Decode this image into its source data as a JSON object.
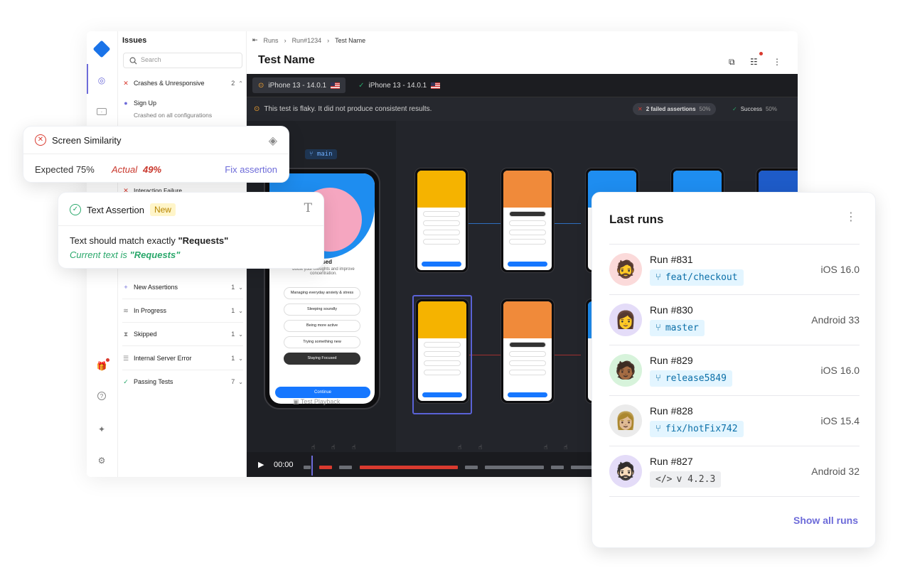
{
  "breadcrumb": [
    "Runs",
    "Run#1234",
    "Test Name"
  ],
  "test_title": "Test Name",
  "issues": {
    "title": "Issues",
    "search_placeholder": "Search",
    "groups": [
      {
        "label": "Crashes & Unresponsive",
        "count": "2",
        "status": "error"
      },
      {
        "label": "New Assertions",
        "count": "1",
        "status": "new"
      },
      {
        "label": "In Progress",
        "count": "1",
        "status": "progress"
      },
      {
        "label": "Skipped",
        "count": "1",
        "status": "skipped"
      },
      {
        "label": "Internal Server Error",
        "count": "1",
        "status": "server"
      },
      {
        "label": "Passing Tests",
        "count": "7",
        "status": "pass"
      }
    ],
    "sub_item": {
      "label": "Sign Up",
      "desc": "Crashed on all configurations"
    },
    "partial_row": "Interaction Failure"
  },
  "device_tabs": [
    {
      "label": "iPhone 13 - 14.0.1",
      "status": "warning"
    },
    {
      "label": "iPhone 13 - 14.0.1",
      "status": "ok"
    }
  ],
  "flaky_notice": "This test is flaky. It did not produce consistent results.",
  "summary": {
    "failed_label": "2 failed assertions",
    "failed_pct": "50%",
    "success_label": "Success",
    "success_pct": "50%"
  },
  "branch_label": "main",
  "phone_screen": {
    "heading_partial": "ocused",
    "sub_partial": "boost your thoughts and improve concentration.",
    "options": [
      "Managing everyday anxiety & stress",
      "Sleeping soundly",
      "Being more active",
      "Trying something new",
      "Staying Focused"
    ],
    "continue": "Continue"
  },
  "playback_label": "Test Playback",
  "timecode": "00:00",
  "screen_similarity": {
    "title": "Screen Similarity",
    "expected": "Expected 75%",
    "actual_label": "Actual",
    "actual_value": "49%",
    "fix_link": "Fix assertion"
  },
  "text_assertion": {
    "title": "Text Assertion",
    "badge": "New",
    "line1_prefix": "Text should match exactly",
    "line1_value": "\"Requests\"",
    "line2_prefix": "Current text is",
    "line2_value": "\"Requests\""
  },
  "last_runs": {
    "title": "Last runs",
    "runs": [
      {
        "name": "Run #831",
        "tag": "feat/checkout",
        "tag_type": "branch",
        "platform": "iOS 16.0",
        "avatar_bg": "#fbdada"
      },
      {
        "name": "Run #830",
        "tag": "master",
        "tag_type": "branch",
        "platform": "Android 33",
        "avatar_bg": "#e4dcf8"
      },
      {
        "name": "Run #829",
        "tag": "release5849",
        "tag_type": "branch",
        "platform": "iOS 16.0",
        "avatar_bg": "#d7f3db"
      },
      {
        "name": "Run #828",
        "tag": "fix/hotFix742",
        "tag_type": "branch",
        "platform": "iOS 15.4",
        "avatar_bg": "#ebebeb"
      },
      {
        "name": "Run #827",
        "tag": "v 4.2.3",
        "tag_type": "version",
        "platform": "Android 32",
        "avatar_bg": "#e4dcf8"
      }
    ],
    "show_all": "Show all runs"
  },
  "colors": {
    "accent": "#6d6bd9",
    "error": "#d93a2f",
    "success": "#2aa86b",
    "dark": "#23252b"
  }
}
